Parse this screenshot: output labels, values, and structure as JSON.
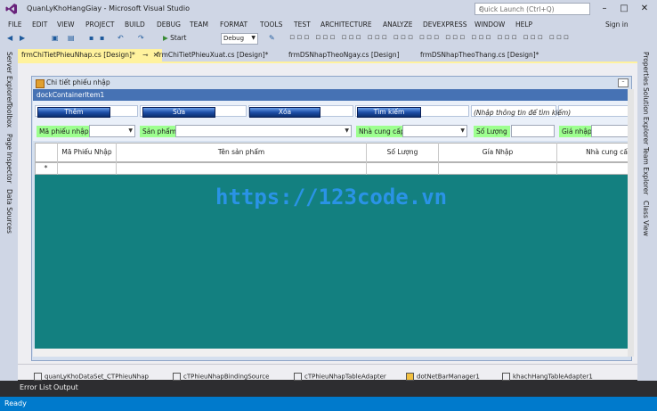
{
  "window": {
    "title": "QuanLyKhoHangGiay - Microsoft Visual Studio",
    "quick_launch_placeholder": "Quick Launch (Ctrl+Q)",
    "sign_in": "Sign in"
  },
  "menu": [
    "FILE",
    "EDIT",
    "VIEW",
    "PROJECT",
    "BUILD",
    "DEBUG",
    "TEAM",
    "FORMAT",
    "TOOLS",
    "TEST",
    "ARCHITECTURE",
    "ANALYZE",
    "DEVEXPRESS",
    "WINDOW",
    "HELP"
  ],
  "toolbar": {
    "start_label": "Start",
    "config_value": "Debug"
  },
  "left_panels": [
    "Server Explorer",
    "Toolbox",
    "Page Inspector",
    "Data Sources"
  ],
  "right_panels": [
    "Properties",
    "Solution Explorer",
    "Team Explorer",
    "Class View"
  ],
  "doc_tabs": [
    "frmChiTietPhieuNhap.cs [Design]*",
    "frmChiTietPhieuXuat.cs [Design]*",
    "frmDSNhapTheoNgay.cs [Design]",
    "frmDSNhapTheoThang.cs [Design]*"
  ],
  "form": {
    "title": "Chi tiết phiếu nhập",
    "dock_label": "dockContainerItem1",
    "buttons": {
      "add": "Thêm",
      "edit": "Sửa",
      "delete": "Xóa",
      "search": "Tìm kiếm"
    },
    "hint": "(Nhập thông tin để tìm kiếm)",
    "fields": {
      "receipt_id": "Mã phiếu nhập",
      "product": "Sản phẩm",
      "supplier": "Nhà cung cấp",
      "quantity": "Số Lượng",
      "price": "Giá nhập"
    },
    "grid_columns": [
      "Mã Phiếu Nhập",
      "Tên sản phẩm",
      "Số Lượng",
      "Gía Nhập",
      "Nhà cung cấ"
    ],
    "new_row_marker": "*"
  },
  "watermark": "https://123code.vn",
  "tray_components": [
    "quanLyKhoDataSet_CTPhieuNhap",
    "cTPhieuNhapBindingSource",
    "cTPhieuNhapTableAdapter",
    "dotNetBarManager1",
    "khachHangTableAdapter1"
  ],
  "bottom_tabs": [
    "Error List",
    "Output"
  ],
  "status": "Ready",
  "colors": {
    "accent": "#007acc",
    "designer_teal": "#138080",
    "label_green": "#9dff8f",
    "dock_blue": "#4672b4"
  }
}
